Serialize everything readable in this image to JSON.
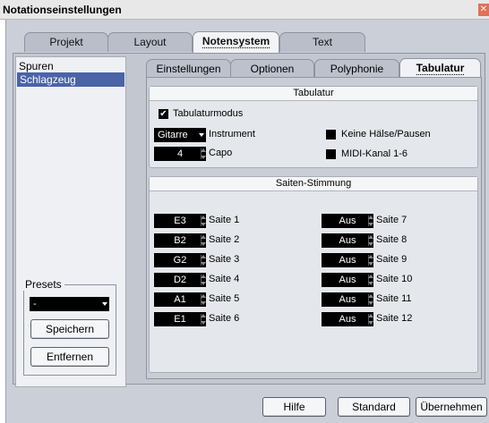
{
  "window": {
    "title": "Notationseinstellungen"
  },
  "main_tabs": [
    "Projekt",
    "Layout",
    "Notensystem",
    "Text"
  ],
  "left": {
    "header": "Spuren",
    "items": [
      "Schlagzeug"
    ],
    "presets_label": "Presets",
    "preset_value": "-",
    "save_label": "Speichern",
    "remove_label": "Entfernen"
  },
  "sub_tabs": [
    "Einstellungen",
    "Optionen",
    "Polyphonie",
    "Tabulatur"
  ],
  "tabulatur": {
    "header": "Tabulatur",
    "mode_label": "Tabulaturmodus",
    "mode_checked": true,
    "instrument_value": "Gitarre",
    "instrument_label": "Instrument",
    "capo_value": "4",
    "capo_label": "Capo",
    "no_stems_label": "Keine Hälse/Pausen",
    "midi_label": "MIDI-Kanal 1-6"
  },
  "tuning": {
    "header": "Saiten-Stimmung",
    "left": [
      {
        "value": "E3",
        "label": "Saite 1"
      },
      {
        "value": "B2",
        "label": "Saite 2"
      },
      {
        "value": "G2",
        "label": "Saite 3"
      },
      {
        "value": "D2",
        "label": "Saite 4"
      },
      {
        "value": "A1",
        "label": "Saite 5"
      },
      {
        "value": "E1",
        "label": "Saite 6"
      }
    ],
    "right": [
      {
        "value": "Aus",
        "label": "Saite 7"
      },
      {
        "value": "Aus",
        "label": "Saite 8"
      },
      {
        "value": "Aus",
        "label": "Saite 9"
      },
      {
        "value": "Aus",
        "label": "Saite 10"
      },
      {
        "value": "Aus",
        "label": "Saite 11"
      },
      {
        "value": "Aus",
        "label": "Saite 12"
      }
    ]
  },
  "footer": {
    "help": "Hilfe",
    "standard": "Standard",
    "apply": "Übernehmen"
  }
}
